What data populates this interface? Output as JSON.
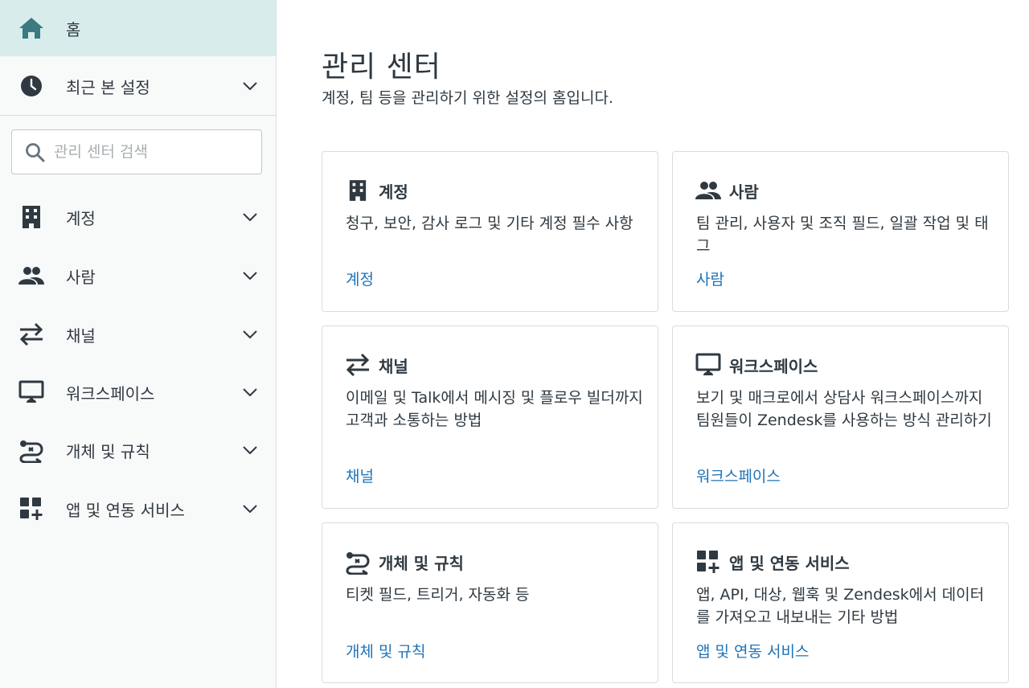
{
  "sidebar": {
    "home_label": "홈",
    "recent_label": "최근 본 설정",
    "search_placeholder": "관리 센터 검색",
    "items": [
      {
        "label": "계정",
        "icon": "building-icon"
      },
      {
        "label": "사람",
        "icon": "people-icon"
      },
      {
        "label": "채널",
        "icon": "arrows-swap-icon"
      },
      {
        "label": "워크스페이스",
        "icon": "monitor-icon"
      },
      {
        "label": "개체 및 규칙",
        "icon": "objects-rules-icon"
      },
      {
        "label": "앱 및 연동 서비스",
        "icon": "apps-add-icon"
      }
    ]
  },
  "main": {
    "title": "관리 센터",
    "subtitle": "계정, 팀 등을 관리하기 위한 설정의 홈입니다.",
    "cards": [
      {
        "title": "계정",
        "description": "청구, 보안, 감사 로그 및 기타 계정 필수 사항",
        "link": "계정"
      },
      {
        "title": "사람",
        "description": "팀 관리, 사용자 및 조직 필드, 일괄 작업 및 태그",
        "link": "사람"
      },
      {
        "title": "채널",
        "description": "이메일 및 Talk에서 메시징 및 플로우 빌더까지 고객과 소통하는 방법",
        "link": "채널"
      },
      {
        "title": "워크스페이스",
        "description": "보기 및 매크로에서 상담사 워크스페이스까지 팀원들이 Zendesk를 사용하는 방식 관리하기",
        "link": "워크스페이스"
      },
      {
        "title": "개체 및 규칙",
        "description": "티켓 필드, 트리거, 자동화 등",
        "link": "개체 및 규칙"
      },
      {
        "title": "앱 및 연동 서비스",
        "description": "앱, API, 대상, 웹훅 및 Zendesk에서 데이터를 가져오고 내보내는 기타 방법",
        "link": "앱 및 연동 서비스"
      }
    ]
  },
  "colors": {
    "sidebar_bg": "#f8f9f9",
    "home_active_bg": "#d9ecec",
    "home_icon": "#3a7a80",
    "link": "#1f73b7",
    "text": "#2f3941"
  }
}
